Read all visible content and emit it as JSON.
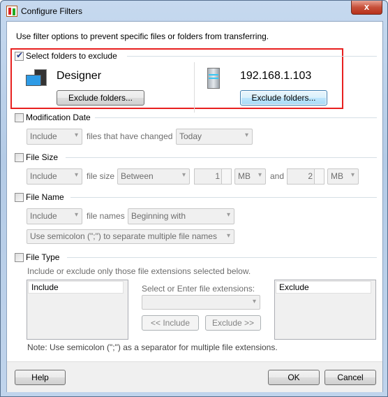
{
  "window": {
    "title": "Configure Filters",
    "close": "x"
  },
  "intro": "Use filter options to prevent specific files or folders from transferring.",
  "folders": {
    "label": "Select folders to exclude",
    "checked": true,
    "left": {
      "name": "Designer",
      "button": "Exclude folders..."
    },
    "right": {
      "name": "192.168.1.103",
      "button": "Exclude folders..."
    }
  },
  "modification": {
    "label": "Modification Date",
    "checked": false,
    "mode": "Include",
    "text": "files that have changed",
    "period": "Today"
  },
  "size": {
    "label": "File Size",
    "checked": false,
    "mode": "Include",
    "text": "file size",
    "op": "Between",
    "min": "1",
    "min_unit": "MB",
    "and": "and",
    "max": "2",
    "max_unit": "MB"
  },
  "name": {
    "label": "File Name",
    "checked": false,
    "mode": "Include",
    "text": "file names",
    "match": "Beginning with",
    "placeholder": "Use semicolon (\";\") to separate multiple file names"
  },
  "type": {
    "label": "File Type",
    "checked": false,
    "desc": "Include or exclude only those file extensions selected below.",
    "include_header": "Include",
    "select_label": "Select or Enter file extensions:",
    "include_btn": "<< Include",
    "exclude_btn": "Exclude >>",
    "exclude_header": "Exclude",
    "note": "Note: Use semicolon (\";\") as a separator for multiple file extensions."
  },
  "buttons": {
    "help": "Help",
    "ok": "OK",
    "cancel": "Cancel"
  },
  "colors": {
    "highlight": "#e8201f"
  }
}
